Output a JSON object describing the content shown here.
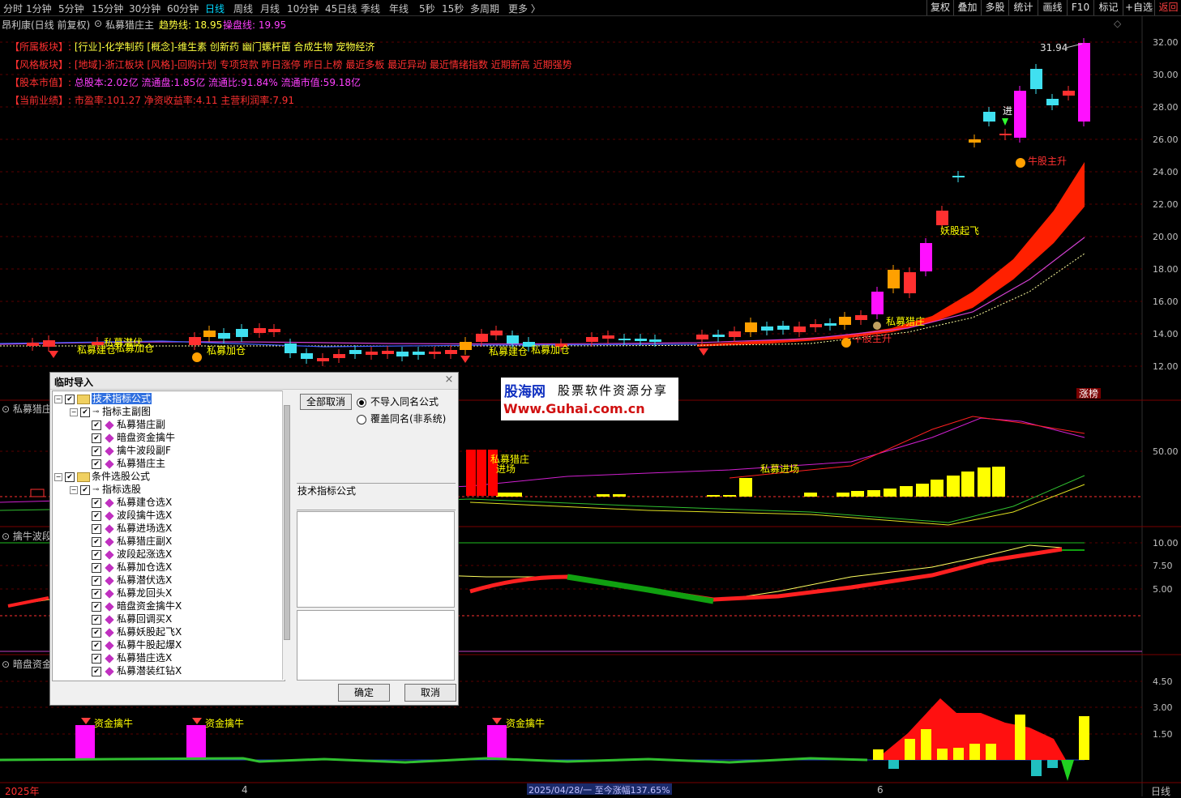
{
  "toolbar": {
    "periods": [
      "分时",
      "1分钟",
      "5分钟",
      "15分钟",
      "30分钟",
      "60分钟",
      "日线",
      "周线",
      "月线",
      "10分钟",
      "45日线",
      "季线",
      "年线",
      "5秒",
      "15秒",
      "多周期",
      "更多 〉"
    ],
    "active_period": "日线",
    "right_buttons": [
      "复权",
      "叠加",
      "多股",
      "统计",
      "画线",
      "F10",
      "标记",
      "+自选",
      "返回"
    ]
  },
  "chart": {
    "stock_title": "昂利康(日线 前复权)",
    "indicator_name": "私募猎庄主",
    "trend_line": "趋势线: 18.95",
    "control_line": "操盘线: 19.95",
    "info": [
      {
        "label": "【所属板块】:",
        "value": "[行业]-化学制药 [概念]-维生素 创新药 幽门螺杆菌 合成生物 宠物经济"
      },
      {
        "label": "【风格板块】:",
        "value": "[地域]-浙江板块 [风格]-回购计划 专项贷款 昨日涨停 昨日上榜 最近多板 最近异动 最近情绪指数 近期新高 近期强势"
      },
      {
        "label": "【股本市值】:",
        "value": "总股本:2.02亿 流通盘:1.85亿 流通比:91.84% 流通市值:59.18亿"
      },
      {
        "label": "【当前业绩】:",
        "value": "市盈率:101.27 净资收益率:4.11 主营利润率:7.91"
      }
    ],
    "price_axis": [
      "32.00",
      "30.00",
      "28.00",
      "26.00",
      "24.00",
      "22.00",
      "20.00",
      "18.00",
      "16.00",
      "14.00",
      "12.00"
    ],
    "high_label": "31.94",
    "limit_tag": "涨榜",
    "annotations": {
      "jiancang": "私募建仓",
      "jiacang": "私募加仓",
      "qianfu": "私募潜伏",
      "yaogu": "妖股起飞",
      "niugu": "牛股主升",
      "liezhuang": "私募猎庄",
      "jinchang": "私募进场",
      "jin": "进",
      "zijin": "资金擒牛"
    },
    "pane2_label": "私募猎庄",
    "pane2_axis": [
      "50.00"
    ],
    "pane3_label": "擒牛波段",
    "pane3_axis": [
      "10.00",
      "7.50",
      "5.00"
    ],
    "pane4_label": "暗盘资金",
    "pane4_axis": [
      "4.50",
      "3.00",
      "1.50"
    ],
    "xaxis": {
      "year": "2025年",
      "m4": "4",
      "m6": "6",
      "status": "2025/04/28/一  至今涨幅137.65%",
      "period": "日线"
    }
  },
  "watermark": {
    "brand": "股海网",
    "slogan": "股票软件资源分享",
    "url": "Www.Guhai.com.cn"
  },
  "dialog": {
    "title": "临时导入",
    "close": "×",
    "tree": [
      {
        "level": 0,
        "type": "folder",
        "label": "技术指标公式",
        "selected": true
      },
      {
        "level": 1,
        "type": "key",
        "label": "指标主副图"
      },
      {
        "level": 2,
        "type": "item",
        "label": "私募猎庄副"
      },
      {
        "level": 2,
        "type": "item",
        "label": "暗盘资金擒牛"
      },
      {
        "level": 2,
        "type": "item",
        "label": "擒牛波段副F"
      },
      {
        "level": 2,
        "type": "item",
        "label": "私募猎庄主"
      },
      {
        "level": 0,
        "type": "folder",
        "label": "条件选股公式"
      },
      {
        "level": 1,
        "type": "key",
        "label": "指标选股"
      },
      {
        "level": 2,
        "type": "item",
        "label": "私募建仓选X"
      },
      {
        "level": 2,
        "type": "item",
        "label": "波段擒牛选X"
      },
      {
        "level": 2,
        "type": "item",
        "label": "私募进场选X"
      },
      {
        "level": 2,
        "type": "item",
        "label": "私募猎庄副X"
      },
      {
        "level": 2,
        "type": "item",
        "label": "波段起涨选X"
      },
      {
        "level": 2,
        "type": "item",
        "label": "私募加仓选X"
      },
      {
        "level": 2,
        "type": "item",
        "label": "私募潜伏选X"
      },
      {
        "level": 2,
        "type": "item",
        "label": "私募龙回头X"
      },
      {
        "level": 2,
        "type": "item",
        "label": "暗盘资金擒牛X"
      },
      {
        "level": 2,
        "type": "item",
        "label": "私募回调买X"
      },
      {
        "level": 2,
        "type": "item",
        "label": "私募妖股起飞X"
      },
      {
        "level": 2,
        "type": "item",
        "label": "私募牛股起爆X"
      },
      {
        "level": 2,
        "type": "item",
        "label": "私募猎庄选X"
      },
      {
        "level": 2,
        "type": "item",
        "label": "私募潜装红钻X"
      }
    ],
    "cancel_all": "全部取消",
    "opt_no_import": "不导入同名公式",
    "opt_overwrite": "覆盖同名(非系统)",
    "section_label": "技术指标公式",
    "ok": "确定",
    "cancel": "取消"
  }
}
